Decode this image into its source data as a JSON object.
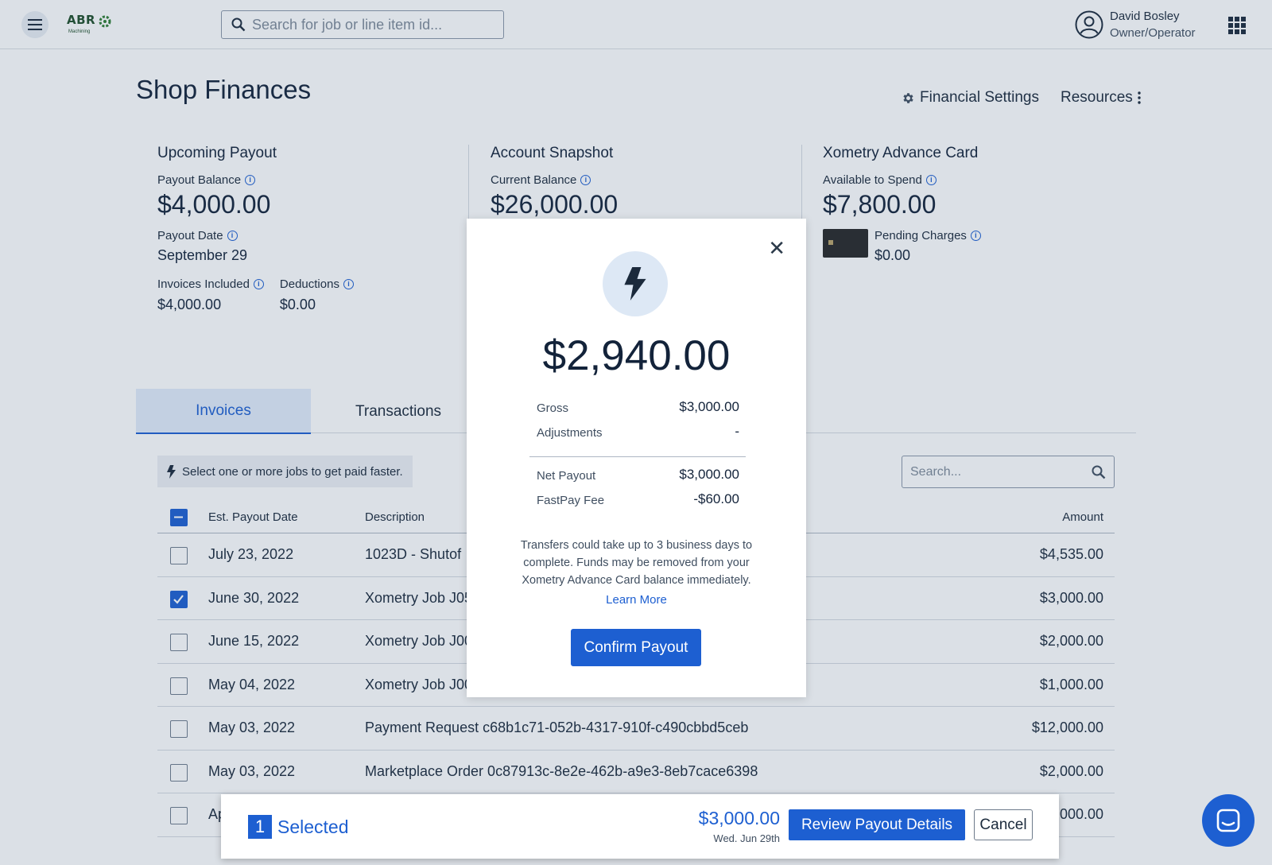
{
  "topbar": {
    "logo_text": "ABR",
    "logo_sub": "Machining",
    "search_placeholder": "Search for job or line item id...",
    "user_name": "David Bosley",
    "user_role": "Owner/Operator"
  },
  "page": {
    "title": "Shop Finances",
    "financial_settings": "Financial Settings",
    "resources": "Resources"
  },
  "summary": {
    "payout": {
      "heading": "Upcoming Payout",
      "balance_label": "Payout Balance",
      "balance": "$4,000.00",
      "date_label": "Payout Date",
      "date": "September 29",
      "invoices_label": "Invoices Included",
      "invoices": "$4,000.00",
      "deductions_label": "Deductions",
      "deductions": "$0.00"
    },
    "account": {
      "heading": "Account Snapshot",
      "balance_label": "Current Balance",
      "balance": "$26,000.00"
    },
    "card": {
      "heading": "Xometry Advance Card",
      "available_label": "Available to Spend",
      "available": "$7,800.00",
      "pending_label": "Pending Charges",
      "pending": "$0.00"
    }
  },
  "tabs": [
    {
      "label": "Invoices"
    },
    {
      "label": "Transactions"
    }
  ],
  "hint": "Select one or more jobs to get paid faster.",
  "table_search_placeholder": "Search...",
  "table": {
    "headers": {
      "date": "Est. Payout Date",
      "description": "Description",
      "amount": "Amount"
    },
    "rows": [
      {
        "date": "July 23, 2022",
        "description": "1023D - Shutof",
        "amount": "$4,535.00",
        "checked": false
      },
      {
        "date": "June 30, 2022",
        "description": "Xometry Job J05",
        "amount": "$3,000.00",
        "checked": true
      },
      {
        "date": "June 15, 2022",
        "description": "Xometry Job J00",
        "amount": "$2,000.00",
        "checked": false
      },
      {
        "date": "May 04, 2022",
        "description": "Xometry Job J00",
        "amount": "$1,000.00",
        "checked": false
      },
      {
        "date": "May 03, 2022",
        "description": "Payment Request c68b1c71-052b-4317-910f-c490cbbd5ceb",
        "amount": "$12,000.00",
        "checked": false
      },
      {
        "date": "May 03, 2022",
        "description": "Marketplace Order 0c87913c-8e2e-462b-a9e3-8eb7cace6398",
        "amount": "$2,000.00",
        "checked": false
      },
      {
        "date": "Ap",
        "description": "",
        "amount": ",000.00",
        "checked": false
      }
    ]
  },
  "selection_bar": {
    "count": "1",
    "label": "Selected",
    "amount": "$3,000.00",
    "date": "Wed. Jun 29th",
    "review_button": "Review Payout Details",
    "cancel_button": "Cancel"
  },
  "modal": {
    "amount": "$2,940.00",
    "rows_top": [
      {
        "label": "Gross",
        "value": "$3,000.00"
      },
      {
        "label": "Adjustments",
        "value": "-"
      }
    ],
    "rows_bottom": [
      {
        "label": "Net Payout",
        "value": "$3,000.00"
      },
      {
        "label": "FastPay Fee",
        "value": "-$60.00"
      }
    ],
    "note": "Transfers could take up to 3 business days to complete. Funds may be removed from your Xometry Advance Card balance immediately.",
    "learn_more": "Learn More",
    "confirm": "Confirm Payout"
  },
  "colors": {
    "accent": "#1d5fd1",
    "text": "#13233a",
    "overlay": "#385274"
  }
}
